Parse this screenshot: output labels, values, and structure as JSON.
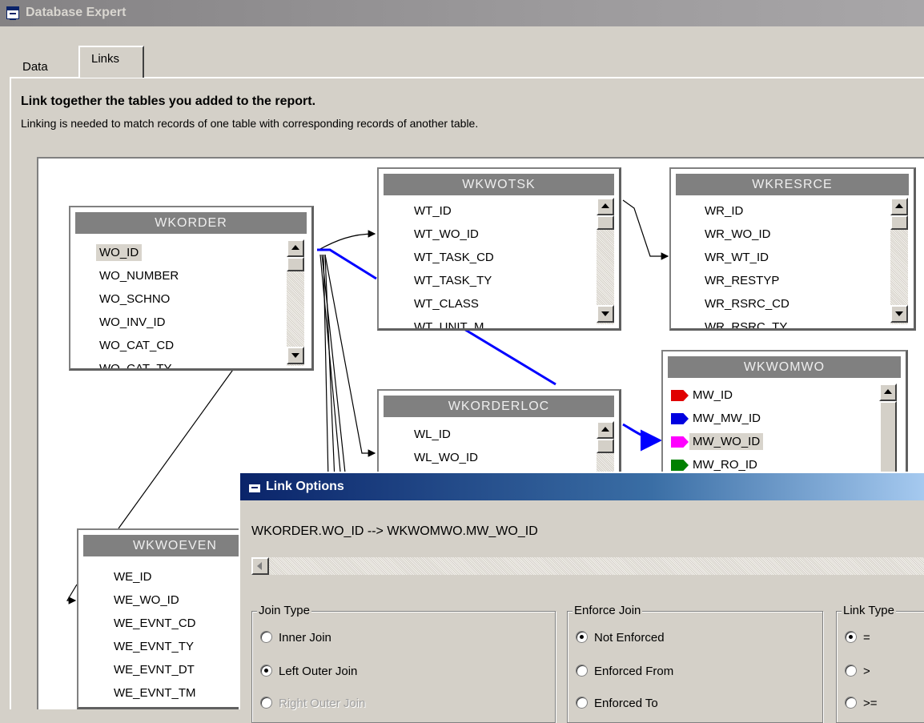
{
  "window": {
    "title": "Database Expert"
  },
  "tabs": [
    {
      "label": "Data"
    },
    {
      "label": "Links"
    }
  ],
  "heading": "Link together the tables you added to the report.",
  "subheading": "Linking is needed to match records of one table with corresponding records of another table.",
  "tables": {
    "wkorder": {
      "name": "WKORDER",
      "fields": [
        "WO_ID",
        "WO_NUMBER",
        "WO_SCHNO",
        "WO_INV_ID",
        "WO_CAT_CD",
        "WO_CAT_TY"
      ]
    },
    "wkwotsk": {
      "name": "WKWOTSK",
      "fields": [
        "WT_ID",
        "WT_WO_ID",
        "WT_TASK_CD",
        "WT_TASK_TY",
        "WT_CLASS",
        "WT_UNIT_M"
      ]
    },
    "wkresrce": {
      "name": "WKRESRCE",
      "fields": [
        "WR_ID",
        "WR_WO_ID",
        "WR_WT_ID",
        "WR_RESTYP",
        "WR_RSRC_CD",
        "WR_RSRC_TY"
      ]
    },
    "wkorderloc": {
      "name": "WKORDERLOC",
      "fields": [
        "WL_ID",
        "WL_WO_ID"
      ]
    },
    "wkwomwo": {
      "name": "WKWOMWO",
      "fields": [
        "MW_ID",
        "MW_MW_ID",
        "MW_WO_ID",
        "MW_RO_ID"
      ],
      "tag_colors": [
        "#e00000",
        "#0000e0",
        "#ff00ff",
        "#008000"
      ]
    },
    "wkwoeven": {
      "name": "WKWOEVEN",
      "fields": [
        "WE_ID",
        "WE_WO_ID",
        "WE_EVNT_CD",
        "WE_EVNT_TY",
        "WE_EVNT_DT",
        "WE_EVNT_TM"
      ]
    }
  },
  "link_options": {
    "title": "Link Options",
    "expression": "WKORDER.WO_ID --> WKWOMWO.MW_WO_ID",
    "join_type": {
      "legend": "Join Type",
      "options": [
        "Inner Join",
        "Left Outer Join",
        "Right Outer Join"
      ],
      "selected": "Left Outer Join"
    },
    "enforce_join": {
      "legend": "Enforce Join",
      "options": [
        "Not Enforced",
        "Enforced From",
        "Enforced To"
      ],
      "selected": "Not Enforced"
    },
    "link_type": {
      "legend": "Link Type",
      "options": [
        "=",
        ">",
        ">="
      ],
      "selected": "="
    }
  },
  "colors": {
    "selected_link": "#0000ff",
    "link": "#000000",
    "dialog_title": "#0a246a"
  }
}
